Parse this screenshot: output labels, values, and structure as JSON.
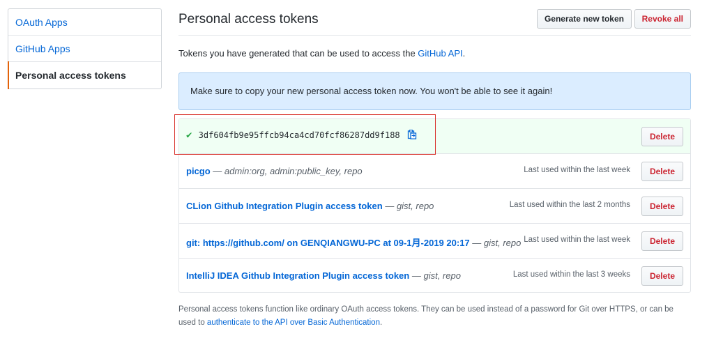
{
  "sidebar": {
    "items": [
      {
        "label": "OAuth Apps"
      },
      {
        "label": "GitHub Apps"
      },
      {
        "label": "Personal access tokens"
      }
    ]
  },
  "header": {
    "title": "Personal access tokens",
    "generate_label": "Generate new token",
    "revoke_label": "Revoke all"
  },
  "intro": {
    "text": "Tokens you have generated that can be used to access the ",
    "link": "GitHub API",
    "suffix": "."
  },
  "flash": {
    "message": "Make sure to copy your new personal access token now. You won't be able to see it again!"
  },
  "new_token": {
    "value": "3df604fb9e95ffcb94ca4cd70fcf86287dd9f188",
    "delete_label": "Delete"
  },
  "tokens": [
    {
      "name": "picgo",
      "dash": " — ",
      "scopes": "admin:org, admin:public_key, repo",
      "last_used": "Last used within the last week",
      "delete_label": "Delete"
    },
    {
      "name": "CLion Github Integration Plugin access token",
      "dash": " — ",
      "scopes": "gist, repo",
      "last_used": "Last used within the last 2 months",
      "delete_label": "Delete"
    },
    {
      "name": "git: https://github.com/ on GENQIANGWU-PC at 09-1月-2019 20:17",
      "dash": " — ",
      "scopes": "gist, repo",
      "last_used": "Last used within the last week",
      "delete_label": "Delete"
    },
    {
      "name": "IntelliJ IDEA Github Integration Plugin access token",
      "dash": " — ",
      "scopes": "gist, repo",
      "last_used": "Last used within the last 3 weeks",
      "delete_label": "Delete"
    }
  ],
  "footer": {
    "text": "Personal access tokens function like ordinary OAuth access tokens. They can be used instead of a password for Git over HTTPS, or can be used to ",
    "link": "authenticate to the API over Basic Authentication",
    "suffix": "."
  },
  "icons": {
    "check": "check-icon",
    "copy": "clipboard-icon"
  },
  "colors": {
    "accent_link": "#0366d6",
    "danger": "#cb2431",
    "success": "#28a745",
    "active_marker": "#e36209",
    "flash_bg": "#dbedff",
    "highlight_border": "#d9312b"
  }
}
